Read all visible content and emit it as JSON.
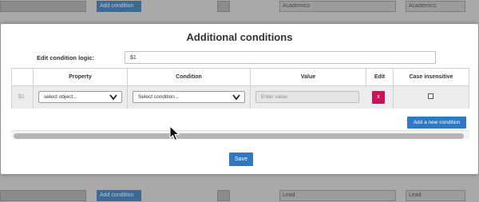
{
  "background": {
    "top_row": {
      "button_label": "Add condition",
      "field1": "Academics",
      "field2": "Academics"
    },
    "bottom_row": {
      "button_label": "Add condition",
      "field1": "Lead",
      "field2": "Lead"
    }
  },
  "modal": {
    "title": "Additional conditions",
    "logic_label": "Edit condition logic:",
    "logic_value": "$1",
    "table": {
      "headers": [
        "Property",
        "Condition",
        "Value",
        "Edit",
        "Case insensitive"
      ],
      "rows": [
        {
          "label": "$1",
          "property_placeholder": "select object...",
          "condition_placeholder": "Select condition...",
          "value_placeholder": "Enter value",
          "edit_label": "x"
        }
      ]
    },
    "add_button_label": "Add a new condition",
    "save_button_label": "Save"
  },
  "colors": {
    "primary": "#2f78c4",
    "delete": "#c8125b"
  },
  "icons": [
    "chevron-down-icon",
    "mouse-pointer-icon"
  ]
}
